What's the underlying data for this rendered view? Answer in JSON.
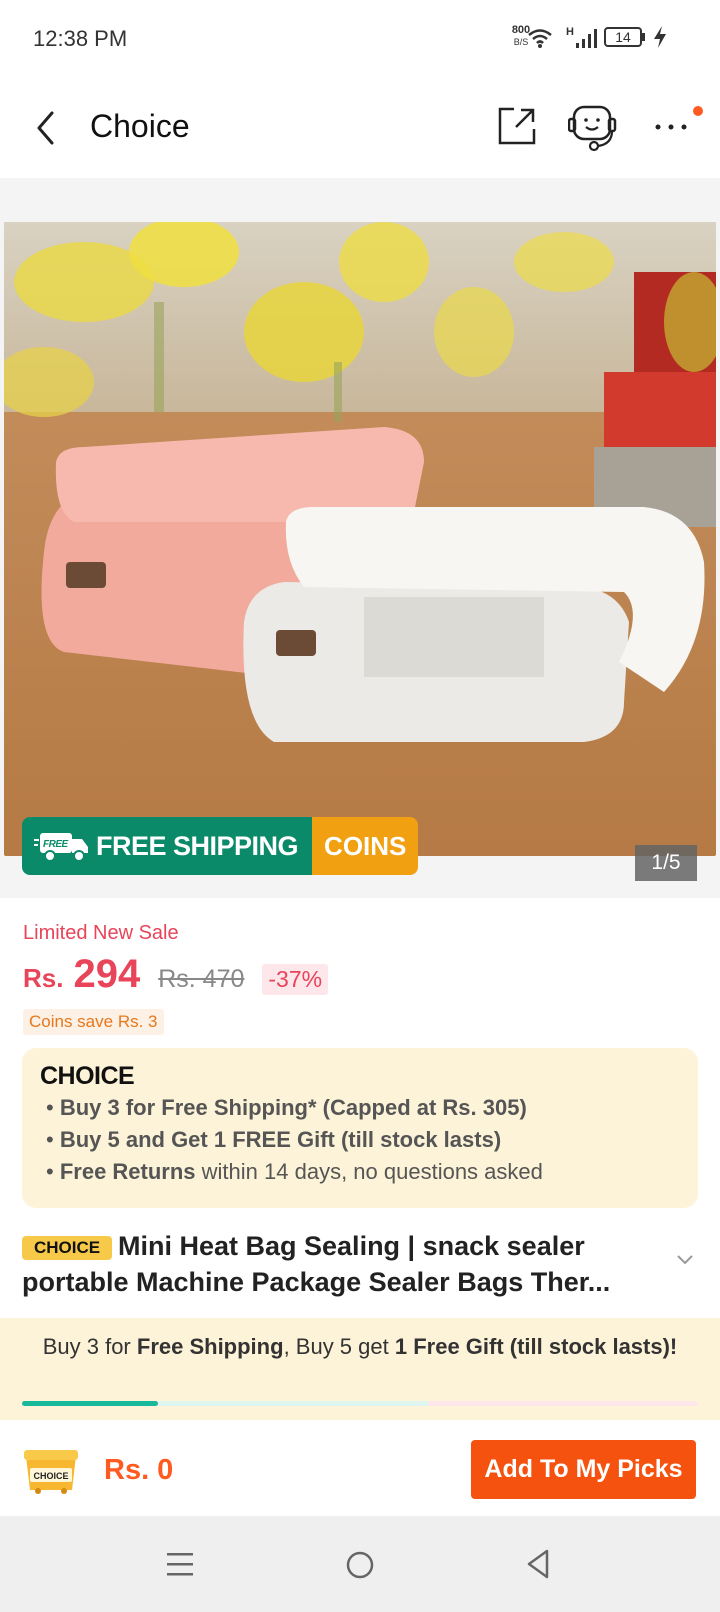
{
  "status": {
    "time": "12:38 PM",
    "net_speed": "800",
    "net_unit": "B/S",
    "signal_label": "H",
    "battery": "14"
  },
  "header": {
    "title": "Choice"
  },
  "gallery": {
    "counter": "1/5",
    "badge_free": "FREE",
    "free_shipping": "FREE SHIPPING",
    "coins": "COINS"
  },
  "price": {
    "promo_label": "Limited New Sale",
    "currency": "Rs.",
    "current": "294",
    "original": "Rs. 470",
    "discount": "-37%",
    "coins_save": "Coins save Rs. 3"
  },
  "choice_box": {
    "logo": "CHOICE",
    "bullets": [
      {
        "bold": "Buy 3 for  Free Shipping* (Capped at Rs. 305)",
        "rest": ""
      },
      {
        "bold": "Buy 5 and Get 1 FREE Gift (till stock lasts)",
        "rest": ""
      },
      {
        "bold": "Free Returns",
        "rest": " within 14 days, no questions asked"
      }
    ]
  },
  "product": {
    "tag": "CHOICE",
    "title_line1": "Mini Heat Bag Sealing | snack sealer",
    "title_line2": "portable Machine Package Sealer Bags Ther..."
  },
  "promo_bar": {
    "p1": "Buy 3 for ",
    "b1": "Free Shipping",
    "p2": ", Buy 5 get ",
    "b2": "1 Free Gift (till stock lasts)!",
    "progress": 0.2
  },
  "bottom": {
    "cart_label": "CHOICE",
    "cart_price": "Rs. 0",
    "add_button": "Add To My Picks"
  },
  "colors": {
    "accent": "#f5520f",
    "sale": "#e8445a",
    "shipping_green": "#0b8a6a",
    "coins_orange": "#f0a010"
  }
}
